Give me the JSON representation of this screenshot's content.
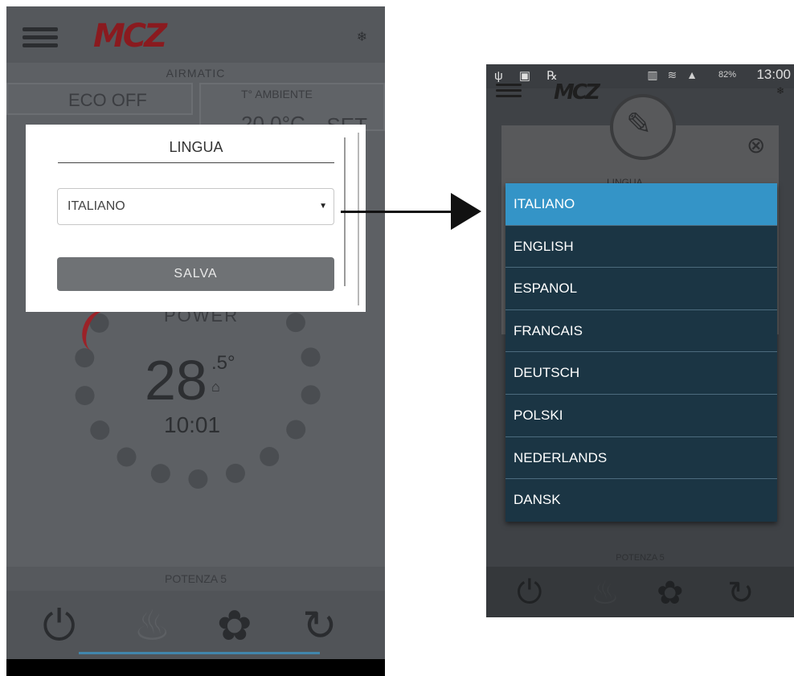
{
  "left": {
    "logo": "MCZ",
    "airmatic": "AIRMATIC",
    "eco": "ECO OFF",
    "ambient_label": "T° AMBIENTE",
    "ambient_value": "20.0°C",
    "set_label": "SET",
    "power_label": "POWER",
    "temp_main": "28",
    "temp_decimal": ".5°",
    "time": "10:01",
    "potenza": "POTENZA 5",
    "dialog": {
      "title": "LINGUA",
      "selected": "ITALIANO",
      "save_label": "SALVA"
    }
  },
  "right": {
    "status": {
      "left_icons": "ψ ▣ ℞",
      "signal": "▥ ≋ ▲",
      "battery": "82%",
      "time": "13:00"
    },
    "logo": "MCZ",
    "lingua_label": "LINGUA",
    "languages": [
      "ITALIANO",
      "ENGLISH",
      "ESPANOL",
      "FRANCAIS",
      "DEUTSCH",
      "POLSKI",
      "NEDERLANDS",
      "DANSK"
    ],
    "selected_language": "ITALIANO",
    "potenza": "POTENZA 5"
  },
  "icons": {
    "menu": "hamburger-icon",
    "snow": "❄",
    "house": "⌂",
    "power": "⏻",
    "flame": "♨",
    "fan": "✿",
    "refresh": "↻",
    "pencil": "✎",
    "close": "⊗",
    "caret": "▼"
  },
  "colors": {
    "brand_red": "#8a1a1f",
    "selected_blue": "#3494c7",
    "list_bg": "#1b3544"
  }
}
